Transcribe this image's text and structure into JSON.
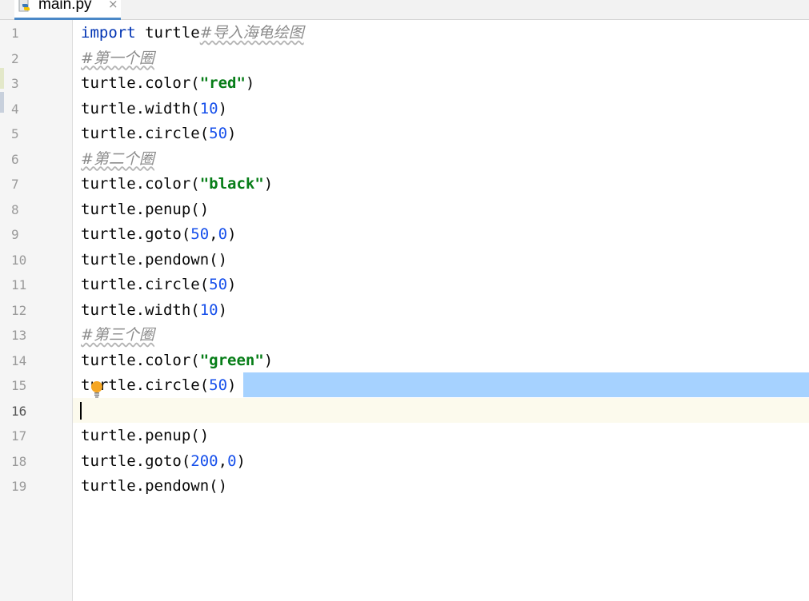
{
  "tab": {
    "label": "main.py",
    "close": "×",
    "icon": "python-file-icon"
  },
  "editor": {
    "line_numbers": [
      "1",
      "2",
      "3",
      "4",
      "5",
      "6",
      "7",
      "8",
      "9",
      "10",
      "11",
      "12",
      "13",
      "14",
      "15",
      "16",
      "17",
      "18",
      "19"
    ],
    "current_line": "16",
    "selected_line": "15",
    "colors": {
      "keyword": "#0033b3",
      "string": "#067d17",
      "number": "#1750eb",
      "comment": "#8c8c8c",
      "selection": "#a6d2ff",
      "caret_line": "#fcfaed"
    },
    "lines": [
      [
        {
          "t": "kw",
          "v": "import"
        },
        {
          "t": "p",
          "v": " turtle"
        },
        {
          "t": "cmt",
          "v": "#导入海龟绘图"
        }
      ],
      [
        {
          "t": "cmt",
          "v": "#第一个圈"
        }
      ],
      [
        {
          "t": "p",
          "v": "turtle.color("
        },
        {
          "t": "str",
          "v": "\"red\""
        },
        {
          "t": "p",
          "v": ")"
        }
      ],
      [
        {
          "t": "p",
          "v": "turtle.width("
        },
        {
          "t": "num",
          "v": "10"
        },
        {
          "t": "p",
          "v": ")"
        }
      ],
      [
        {
          "t": "p",
          "v": "turtle.circle("
        },
        {
          "t": "num",
          "v": "50"
        },
        {
          "t": "p",
          "v": ")"
        }
      ],
      [
        {
          "t": "cmt",
          "v": "#第二个圈"
        }
      ],
      [
        {
          "t": "p",
          "v": "turtle.color("
        },
        {
          "t": "str",
          "v": "\"black\""
        },
        {
          "t": "p",
          "v": ")"
        }
      ],
      [
        {
          "t": "p",
          "v": "turtle.penup()"
        }
      ],
      [
        {
          "t": "p",
          "v": "turtle.goto("
        },
        {
          "t": "num",
          "v": "50"
        },
        {
          "t": "p",
          "v": ","
        },
        {
          "t": "num",
          "v": "0"
        },
        {
          "t": "p",
          "v": ")"
        }
      ],
      [
        {
          "t": "p",
          "v": "turtle.pendown()"
        }
      ],
      [
        {
          "t": "p",
          "v": "turtle.circle("
        },
        {
          "t": "num",
          "v": "50"
        },
        {
          "t": "p",
          "v": ")"
        }
      ],
      [
        {
          "t": "p",
          "v": "turtle.width("
        },
        {
          "t": "num",
          "v": "10"
        },
        {
          "t": "p",
          "v": ")"
        }
      ],
      [
        {
          "t": "cmt",
          "v": "#第三个圈"
        }
      ],
      [
        {
          "t": "p",
          "v": "turtle.color("
        },
        {
          "t": "str",
          "v": "\"green\""
        },
        {
          "t": "p",
          "v": ")"
        }
      ],
      [
        {
          "t": "p",
          "v": "turtle.circle("
        },
        {
          "t": "num",
          "v": "50"
        },
        {
          "t": "p",
          "v": ")"
        }
      ],
      [],
      [
        {
          "t": "p",
          "v": "turtle.penup()"
        }
      ],
      [
        {
          "t": "p",
          "v": "turtle.goto("
        },
        {
          "t": "num",
          "v": "200"
        },
        {
          "t": "p",
          "v": ","
        },
        {
          "t": "num",
          "v": "0"
        },
        {
          "t": "p",
          "v": ")"
        }
      ],
      [
        {
          "t": "p",
          "v": "turtle.pendown()"
        }
      ]
    ],
    "intention_icon": "lightbulb-icon"
  }
}
